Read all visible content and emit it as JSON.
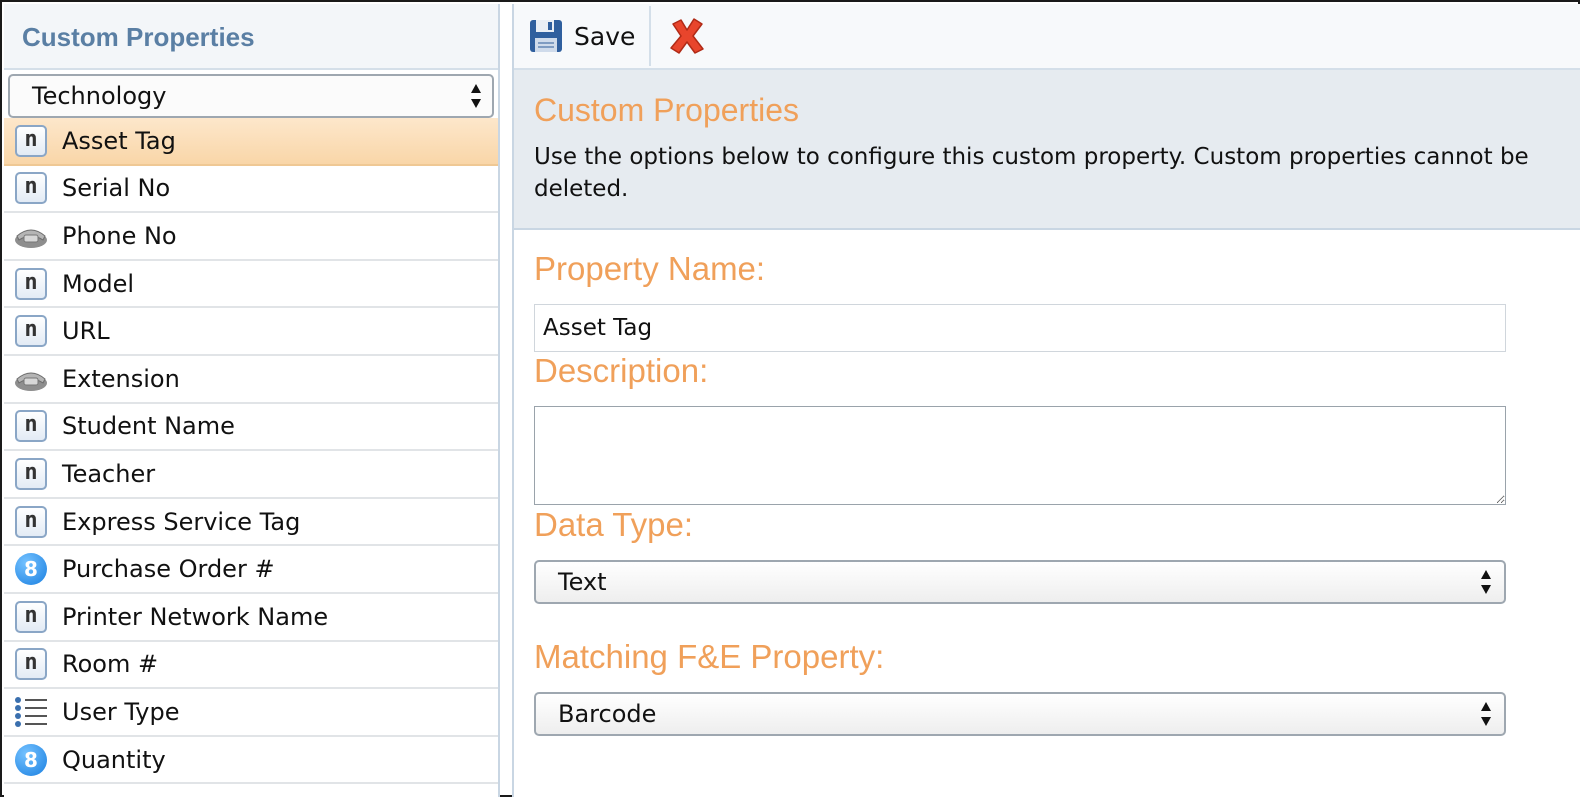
{
  "left_panel": {
    "title": "Custom Properties",
    "category_select": {
      "selected": "Technology"
    },
    "items": [
      {
        "label": "Asset Tag",
        "icon": "text-n-icon",
        "selected": true
      },
      {
        "label": "Serial No",
        "icon": "text-n-icon"
      },
      {
        "label": "Phone No",
        "icon": "phone-icon"
      },
      {
        "label": "Model",
        "icon": "text-n-icon"
      },
      {
        "label": "URL",
        "icon": "text-n-icon"
      },
      {
        "label": "Extension",
        "icon": "phone-icon"
      },
      {
        "label": "Student Name",
        "icon": "text-n-icon"
      },
      {
        "label": "Teacher",
        "icon": "text-n-icon"
      },
      {
        "label": "Express Service Tag",
        "icon": "text-n-icon"
      },
      {
        "label": "Purchase Order #",
        "icon": "number-icon"
      },
      {
        "label": "Printer Network Name",
        "icon": "text-n-icon"
      },
      {
        "label": "Room #",
        "icon": "text-n-icon"
      },
      {
        "label": "User Type",
        "icon": "list-icon"
      },
      {
        "label": "Quantity",
        "icon": "number-icon"
      }
    ]
  },
  "toolbar": {
    "save_label": "Save",
    "save_icon": "floppy-disk-icon",
    "cancel_icon": "red-x-icon"
  },
  "info": {
    "title": "Custom Properties",
    "text": "Use the options below to configure this custom property. Custom properties cannot be deleted."
  },
  "form": {
    "property_name_label": "Property Name:",
    "property_name_value": "Asset Tag",
    "description_label": "Description:",
    "description_value": "",
    "data_type_label": "Data Type:",
    "data_type_value": "Text",
    "matching_label": "Matching F&E Property:",
    "matching_value": "Barcode"
  },
  "colors": {
    "accent_orange": "#f0a05a",
    "header_blue": "#5a7fa4",
    "selected_row": "#fbdcb4"
  }
}
